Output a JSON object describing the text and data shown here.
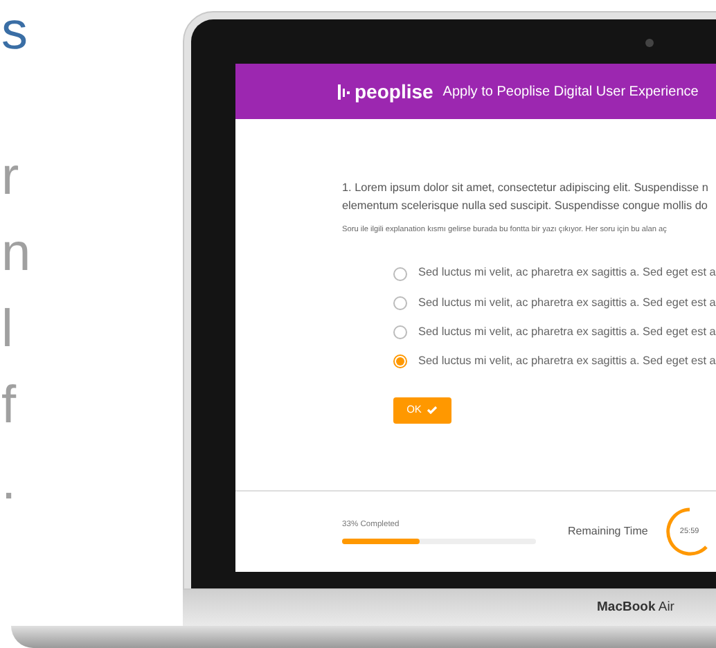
{
  "side_text": [
    {
      "text": "s",
      "accent": true
    },
    {
      "text": "r",
      "accent": false
    },
    {
      "text": "n",
      "accent": false
    },
    {
      "text": "l",
      "accent": false
    },
    {
      "text": "f",
      "accent": false
    },
    {
      "text": ".",
      "accent": false
    }
  ],
  "header": {
    "logo": "peoplise",
    "title": "Apply to Peoplise Digital User Experience"
  },
  "question": {
    "text": "1. Lorem ipsum dolor sit amet, consectetur adipiscing elit. Suspendisse n",
    "text_2": "elementum scelerisque nulla sed suscipit. Suspendisse congue mollis do",
    "explanation": "Soru ile ilgili explanation kısmı gelirse burada bu fontta bir yazı çıkıyor. Her soru için bu alan aç"
  },
  "options": [
    {
      "label": "Sed luctus mi velit, ac pharetra ex sagittis a. Sed eget est a",
      "selected": false
    },
    {
      "label": "Sed luctus mi velit, ac pharetra ex sagittis a. Sed eget est a",
      "selected": false
    },
    {
      "label": "Sed luctus mi velit, ac pharetra ex sagittis a. Sed eget est a",
      "selected": false
    },
    {
      "label": "Sed luctus mi velit, ac pharetra ex sagittis a. Sed eget est a",
      "selected": true
    }
  ],
  "ok_button": "OK",
  "footer": {
    "progress_label": "33% Completed",
    "level": 0.4,
    "remaining_label": "Remaining Time",
    "timer": "25:59"
  },
  "laptop_label": {
    "brand": "MacBook",
    "model": "Air"
  }
}
